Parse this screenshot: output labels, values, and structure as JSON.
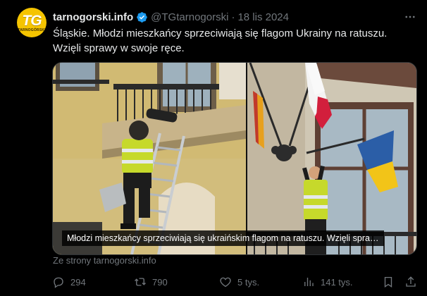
{
  "account": {
    "name": "tarnogorski.info",
    "handle": "@TGtarnogorski",
    "date": "18 lis 2024",
    "separator": "·",
    "avatar_mark": "TG",
    "avatar_sub": "TARNOGÓRSKI"
  },
  "post": {
    "text_line1": "Śląskie. Młodzi mieszkańcy sprzeciwiają się flagom Ukrainy na ratuszu.",
    "text_line2": "Wzięli sprawy w swoje ręce."
  },
  "media": {
    "caption": "Młodzi mieszkańcy sprzeciwiają się ukraińskim flagom na ratuszu. Wzięli spra…",
    "source": "Ze strony tarnogorski.info"
  },
  "actions": {
    "replies": "294",
    "reposts": "790",
    "likes": "5 tys.",
    "views": "141 tys."
  },
  "colors": {
    "background": "#000000",
    "text": "#e7e9ea",
    "muted": "#71767b",
    "verified": "#1d9bf0",
    "avatar": "#f5c400"
  },
  "icons": [
    "verified-badge-icon",
    "more-options-icon",
    "reply-icon",
    "repost-icon",
    "like-icon",
    "views-icon",
    "bookmark-icon",
    "share-icon"
  ]
}
